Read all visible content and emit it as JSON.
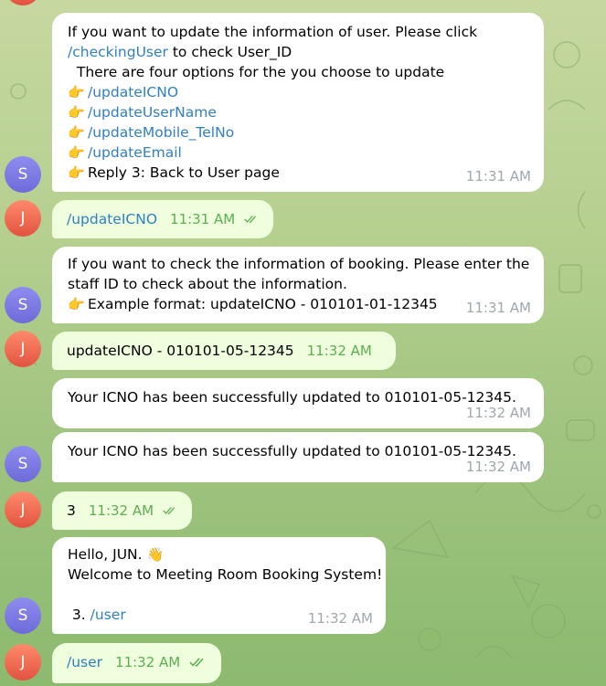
{
  "chat": {
    "avatars": {
      "bot": "S",
      "user": "J"
    },
    "messages": [
      {
        "id": "m1",
        "from": "bot",
        "lines": [
          [
            {
              "t": "text",
              "v": "If you want to update the information of user. Please click"
            }
          ],
          [
            {
              "t": "cmd",
              "v": "/checkingUser"
            },
            {
              "t": "text",
              "v": " to check User_ID"
            }
          ],
          [
            {
              "t": "text",
              "v": "  There are four options for the you choose to update"
            }
          ],
          [
            {
              "t": "emoji",
              "v": "👉"
            },
            {
              "t": "cmd",
              "v": "/updateICNO"
            }
          ],
          [
            {
              "t": "emoji",
              "v": "👉"
            },
            {
              "t": "cmd",
              "v": "/updateUserName"
            }
          ],
          [
            {
              "t": "emoji",
              "v": "👉"
            },
            {
              "t": "cmd",
              "v": "/updateMobile_TelNo"
            }
          ],
          [
            {
              "t": "emoji",
              "v": "👉"
            },
            {
              "t": "cmd",
              "v": "/updateEmail"
            }
          ],
          [
            {
              "t": "emoji",
              "v": "👉"
            },
            {
              "t": "text",
              "v": "Reply 3: Back to User page"
            }
          ]
        ],
        "time": "11:31 AM"
      },
      {
        "id": "m2",
        "from": "user",
        "lines": [
          [
            {
              "t": "cmd",
              "v": "/updateICNO"
            }
          ]
        ],
        "time": "11:31 AM"
      },
      {
        "id": "m3",
        "from": "bot",
        "lines": [
          [
            {
              "t": "text",
              "v": "If you want to check the information of booking. Please enter the"
            }
          ],
          [
            {
              "t": "text",
              "v": "staff ID to check about the information."
            }
          ],
          [
            {
              "t": "emoji",
              "v": "👉"
            },
            {
              "t": "text",
              "v": "Example format: updateICNO - 010101-01-12345"
            }
          ]
        ],
        "time": "11:31 AM"
      },
      {
        "id": "m4",
        "from": "user",
        "lines": [
          [
            {
              "t": "text",
              "v": "updateICNO - 010101-05-12345"
            }
          ]
        ],
        "time": "11:32 AM"
      },
      {
        "id": "m5",
        "from": "bot",
        "lines": [
          [
            {
              "t": "text",
              "v": "Your ICNO has been successfully updated to 010101-05-12345."
            }
          ]
        ],
        "time": "11:32 AM"
      },
      {
        "id": "m6",
        "from": "bot",
        "lines": [
          [
            {
              "t": "text",
              "v": "Your ICNO has been successfully updated to 010101-05-12345."
            }
          ]
        ],
        "time": "11:32 AM"
      },
      {
        "id": "m7",
        "from": "user",
        "lines": [
          [
            {
              "t": "text",
              "v": "3"
            }
          ]
        ],
        "time": "11:32 AM"
      },
      {
        "id": "m8",
        "from": "bot",
        "lines": [
          [
            {
              "t": "text",
              "v": "Hello, JUN. "
            },
            {
              "t": "emoji",
              "v": "👋"
            }
          ],
          [
            {
              "t": "text",
              "v": "Welcome to Meeting Room Booking System!"
            }
          ],
          [
            {
              "t": "text",
              "v": ""
            }
          ],
          [
            {
              "t": "text",
              "v": " 3. "
            },
            {
              "t": "cmd",
              "v": "/user"
            }
          ]
        ],
        "time": "11:32 AM"
      },
      {
        "id": "m9",
        "from": "user",
        "lines": [
          [
            {
              "t": "cmd",
              "v": "/user"
            }
          ]
        ],
        "time": "11:32 AM"
      }
    ]
  },
  "colors": {
    "incoming_bubble": "#ffffff",
    "outgoing_bubble": "#effedd",
    "command_link": "#2f7fc2",
    "outgoing_time": "#5fad52",
    "incoming_time": "#a0a7ad",
    "bot_avatar": "#7b79e3",
    "user_avatar": "#ec6a51"
  }
}
